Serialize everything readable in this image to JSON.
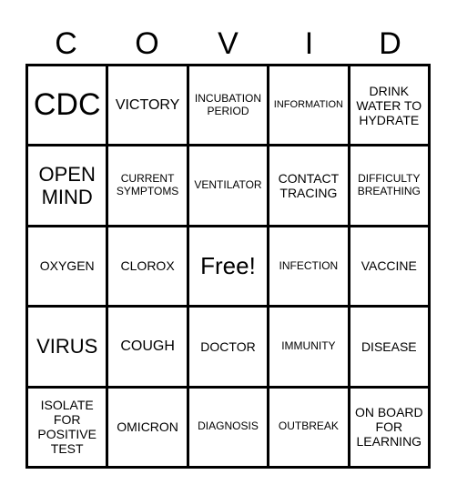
{
  "title_letters": [
    "C",
    "O",
    "V",
    "I",
    "D"
  ],
  "cells": [
    [
      "CDC",
      "VICTORY",
      "INCUBATION PERIOD",
      "INFORMATION",
      "DRINK WATER TO HYDRATE"
    ],
    [
      "OPEN MIND",
      "CURRENT SYMPTOMS",
      "VENTILATOR",
      "CONTACT TRACING",
      "DIFFICULTY BREATHING"
    ],
    [
      "OXYGEN",
      "CLOROX",
      "Free!",
      "INFECTION",
      "VACCINE"
    ],
    [
      "VIRUS",
      "COUGH",
      "DOCTOR",
      "IMMUNITY",
      "DISEASE"
    ],
    [
      "ISOLATE FOR POSITIVE TEST",
      "OMICRON",
      "DIAGNOSIS",
      "OUTBREAK",
      "ON BOARD FOR LEARNING"
    ]
  ]
}
